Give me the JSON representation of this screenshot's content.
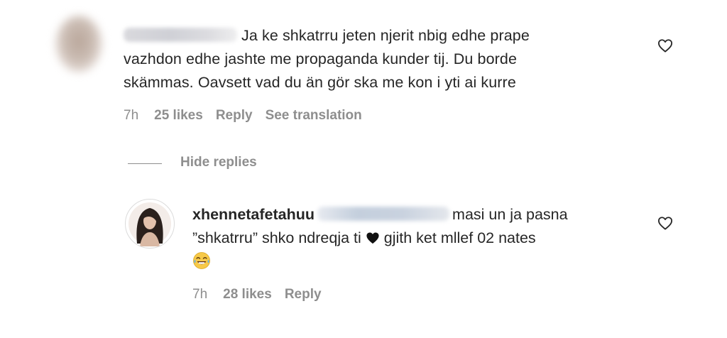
{
  "comment": {
    "text_line1": "Ja ke shkatrru jeten njerit nbig edhe prape",
    "text_line2": "vazhdon edhe jashte me propaganda kunder tij. Du borde",
    "text_line3": "skämmas. Oavsett vad du än gör ska me kon i yti ai kurre",
    "time": "7h",
    "likes": "25 likes",
    "reply_label": "Reply",
    "translation_label": "See translation"
  },
  "hide_replies_label": "Hide replies",
  "reply": {
    "username": "xhennetafetahuu",
    "text_part1": "masi un ja pasna",
    "text_part2": "”shkatrru” shko ndreqja ti",
    "text_part3": "gjith ket mllef 02 nates",
    "time": "7h",
    "likes": "28 likes",
    "reply_label": "Reply"
  },
  "icons": {
    "like": "heart-outline-icon",
    "black_heart": "black-heart-emoji",
    "laughing": "tears-of-joy-emoji"
  },
  "colors": {
    "text": "#262626",
    "meta": "#8e8e8e",
    "background": "#ffffff"
  }
}
